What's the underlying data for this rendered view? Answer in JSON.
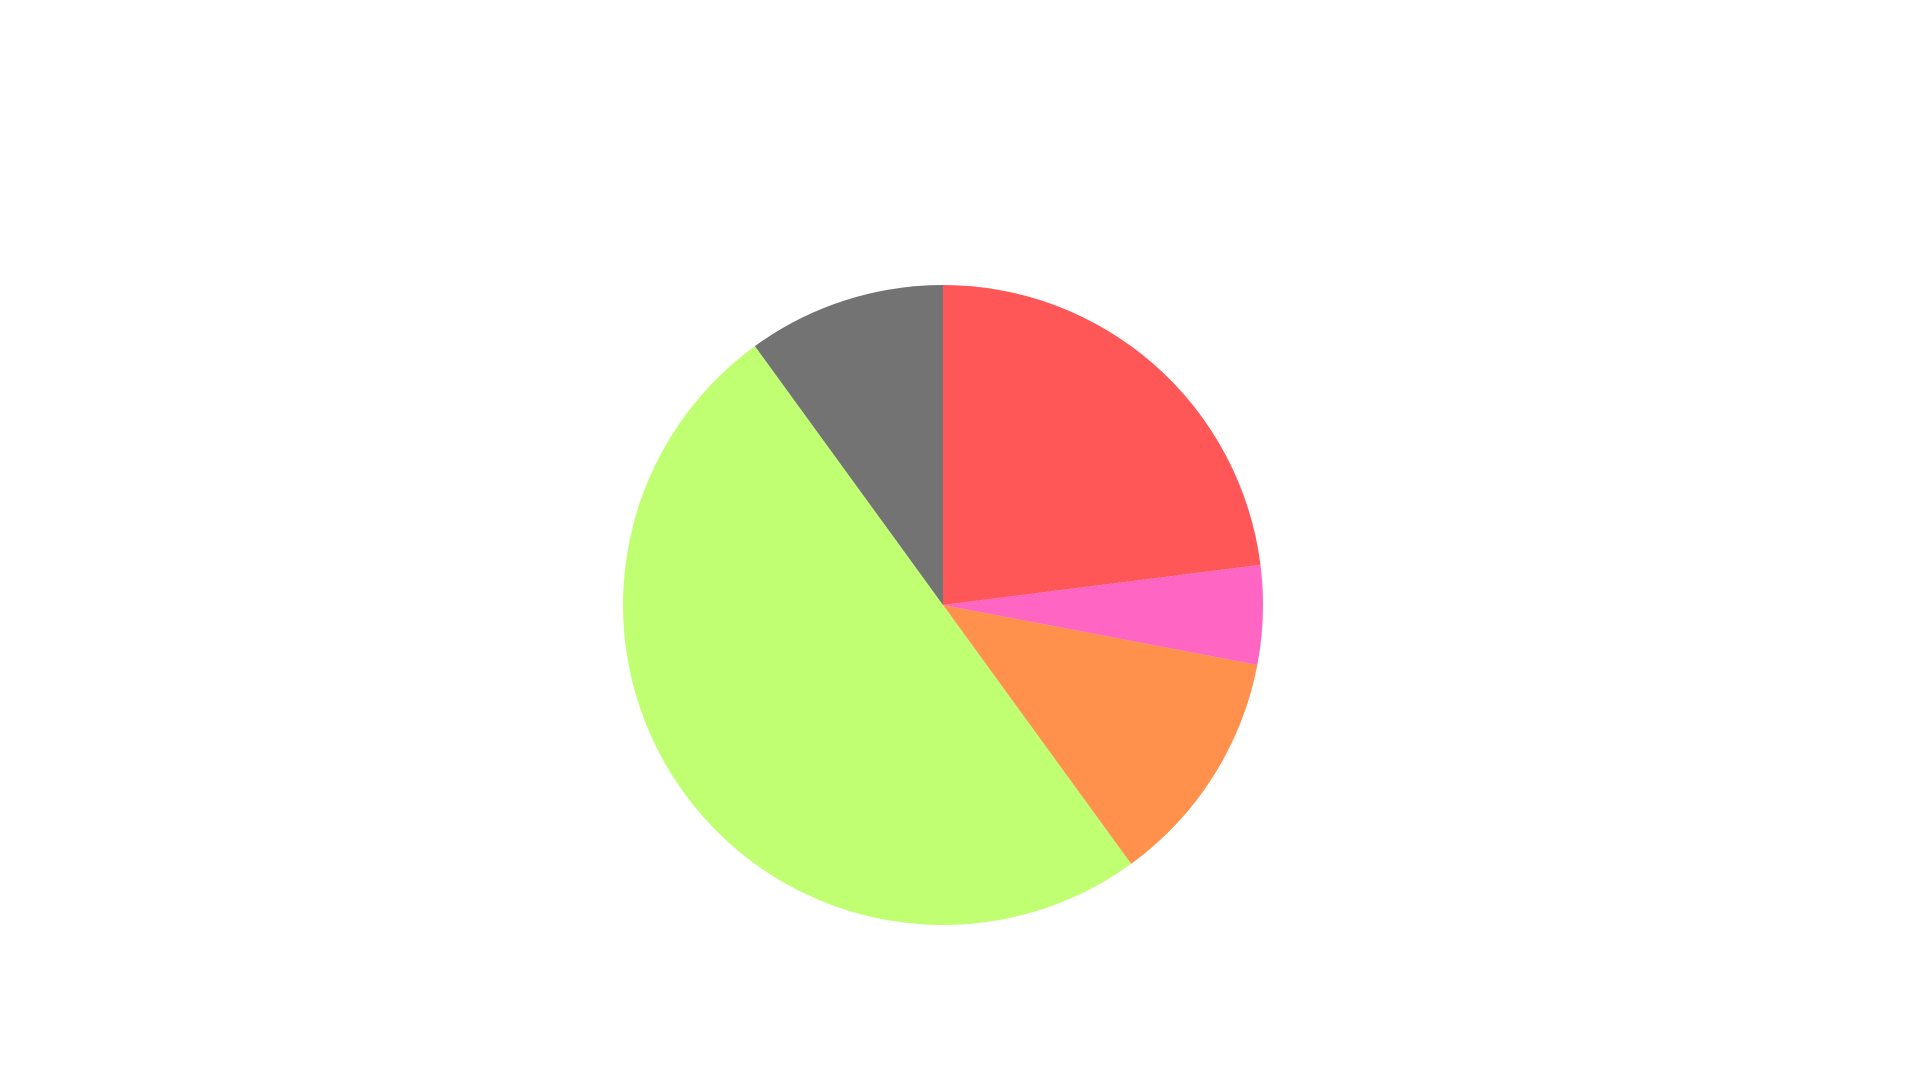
{
  "chart_data": {
    "type": "pie",
    "start_angle_deg": 90,
    "direction": "clockwise",
    "slices": [
      {
        "value": 23.0,
        "color": "#ff5757"
      },
      {
        "value": 5.0,
        "color": "#ff66c4"
      },
      {
        "value": 12.0,
        "color": "#ff914d"
      },
      {
        "value": 50.0,
        "color": "#c1ff72"
      },
      {
        "value": 10.0,
        "color": "#737373"
      }
    ]
  }
}
